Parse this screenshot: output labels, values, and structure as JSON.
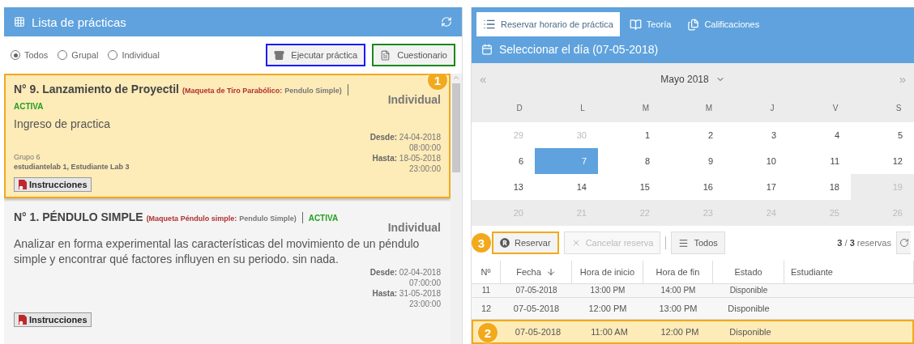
{
  "left_panel": {
    "title": "Lista de prácticas",
    "filters": [
      {
        "label": "Todos",
        "selected": true
      },
      {
        "label": "Grupal",
        "selected": false
      },
      {
        "label": "Individual",
        "selected": false
      }
    ],
    "actions": [
      {
        "label": "Ejecutar práctica",
        "kind": "run"
      },
      {
        "label": "Cuestionario",
        "kind": "quiz"
      }
    ],
    "practices": [
      {
        "title": "N° 9. Lanzamiento de Proyectil",
        "model_label": "(Maqueta de Tiro Parabólico:",
        "model_name": "Pendulo Simple)",
        "status": "ACTIVA",
        "mode": "Individual",
        "description": "Ingreso de practica",
        "group": "Grupo 6",
        "students": "estudiantelab 1, Estudiante Lab 3",
        "desde": "**Desde:** 24-04-2018",
        "desde_time": "08:00:00",
        "hasta": "**Hasta:** 18-05-2018",
        "hasta_time": "23:00:00",
        "button": "Instrucciones",
        "selected": true,
        "badge": "1"
      },
      {
        "title": "N° 1. PÉNDULO SIMPLE",
        "model_label": "(Maqueta Péndulo simple:",
        "model_name": "Pendulo Simple)",
        "status": "ACTIVA",
        "mode": "Individual",
        "description": "Analizar en forma experimental las características del movimiento de un péndulo simple y encontrar qué factores influyen en su periodo. sin nada.",
        "desde": "**Desde:** 02-04-2018",
        "desde_time": "07:00:00",
        "hasta": "**Hasta:** 31-05-2018",
        "hasta_time": "23:00:00",
        "button": "Instrucciones",
        "selected": false
      }
    ]
  },
  "right_panel": {
    "tabs": [
      {
        "label": "Reservar horario de práctica",
        "kind": "list",
        "selected": true
      },
      {
        "label": "Teoría",
        "kind": "book",
        "selected": false
      },
      {
        "label": "Calificaciones",
        "kind": "files",
        "selected": false
      }
    ],
    "day_header": "Seleccionar el día (07-05-2018)",
    "calendar": {
      "prev": "«",
      "month": "Mayo 2018",
      "next": "»",
      "weekdays": [
        "D",
        "L",
        "M",
        "M",
        "J",
        "V",
        "S"
      ],
      "weeks": [
        [
          {
            "day": "29",
            "kind": "other"
          },
          {
            "day": "30",
            "kind": "other"
          },
          {
            "day": "1",
            "kind": "normal"
          },
          {
            "day": "2",
            "kind": "normal"
          },
          {
            "day": "3",
            "kind": "normal"
          },
          {
            "day": "4",
            "kind": "normal"
          },
          {
            "day": "5",
            "kind": "normal"
          }
        ],
        [
          {
            "day": "6",
            "kind": "normal"
          },
          {
            "day": "7",
            "kind": "selected"
          },
          {
            "day": "8",
            "kind": "normal"
          },
          {
            "day": "9",
            "kind": "normal"
          },
          {
            "day": "10",
            "kind": "normal"
          },
          {
            "day": "11",
            "kind": "normal"
          },
          {
            "day": "12",
            "kind": "normal"
          }
        ],
        [
          {
            "day": "13",
            "kind": "normal"
          },
          {
            "day": "14",
            "kind": "normal"
          },
          {
            "day": "15",
            "kind": "normal"
          },
          {
            "day": "16",
            "kind": "normal"
          },
          {
            "day": "17",
            "kind": "normal"
          },
          {
            "day": "18",
            "kind": "normal"
          },
          {
            "day": "19",
            "kind": "disabled"
          }
        ],
        [
          {
            "day": "20",
            "kind": "disabled"
          },
          {
            "day": "21",
            "kind": "disabled"
          },
          {
            "day": "22",
            "kind": "disabled"
          },
          {
            "day": "23",
            "kind": "disabled"
          },
          {
            "day": "24",
            "kind": "disabled"
          },
          {
            "day": "25",
            "kind": "disabled"
          },
          {
            "day": "26",
            "kind": "disabled"
          }
        ]
      ]
    },
    "toolbar": {
      "reserve": {
        "label": "Reservar",
        "badge": "3"
      },
      "cancel": {
        "label": "Cancelar reserva",
        "disabled": true
      },
      "filter": {
        "label": "Todos"
      },
      "count": "**3** / **3** reservas"
    },
    "table": {
      "columns": [
        "Nº",
        "Fecha",
        "Hora de inicio",
        "Hora de fin",
        "Estado",
        "Estudiante"
      ],
      "rows": [
        {
          "cells": [
            "11",
            "07-05-2018",
            "13:00 PM",
            "14:00 PM",
            "Disponible",
            ""
          ],
          "selected": false
        },
        {
          "cells": [
            "12",
            "07-05-2018",
            "12:00 PM",
            "13:00 PM",
            "Disponible",
            ""
          ],
          "selected": false
        },
        {
          "cells": [
            "",
            "07-05-2018",
            "11:00 AM",
            "12:00 PM",
            "Disponible",
            ""
          ],
          "selected": true,
          "badge": "2"
        }
      ]
    }
  }
}
